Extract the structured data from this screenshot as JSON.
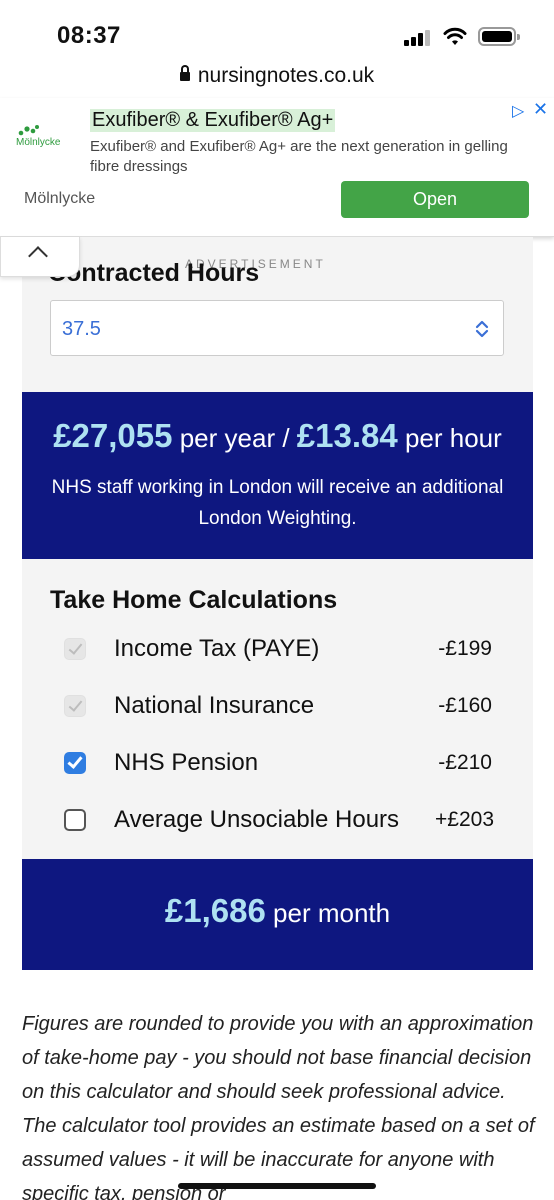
{
  "status_bar": {
    "time": "08:37"
  },
  "browser": {
    "url": "nursingnotes.co.uk"
  },
  "ad": {
    "logo_text": "Mölnlycke",
    "title": "Exufiber® & Exufiber® Ag+",
    "description": "Exufiber® and Exufiber® Ag+ are the next generation in gelling fibre dressings",
    "brand": "Mölnlycke",
    "open_label": "Open",
    "label": "ADVERTISEMENT",
    "close_glyph": "✕",
    "adchoices_glyph": "▷"
  },
  "calculator": {
    "contracted_hours_label": "Contracted Hours",
    "contracted_hours_value": "37.5",
    "salary": {
      "annual": "£27,055",
      "per_year_label": "per year /",
      "hourly": "£13.84",
      "per_hour_label": "per hour",
      "note": "NHS staff working in London will receive an additional London Weighting."
    },
    "take_home_title": "Take Home Calculations",
    "deductions": [
      {
        "label": "Income Tax (PAYE)",
        "amount": "-£199",
        "state": "disabled"
      },
      {
        "label": "National Insurance",
        "amount": "-£160",
        "state": "disabled"
      },
      {
        "label": "NHS Pension",
        "amount": "-£210",
        "state": "checked"
      },
      {
        "label": "Average Unsociable Hours",
        "amount": "+£203",
        "state": "unchecked"
      }
    ],
    "monthly": {
      "amount": "£1,686",
      "label": "per month"
    }
  },
  "disclaimer": "Figures are rounded to provide you with an approximation of take-home pay - you should not base financial decision on this calculator and should seek professional advice. The calculator tool provides an estimate based on a set of assumed values - it will be inaccurate for anyone with specific tax, pension or",
  "colors": {
    "navy": "#0e1780",
    "highlight": "#aee1f2",
    "accent": "#2f7de1",
    "ad_green": "#43a447"
  }
}
